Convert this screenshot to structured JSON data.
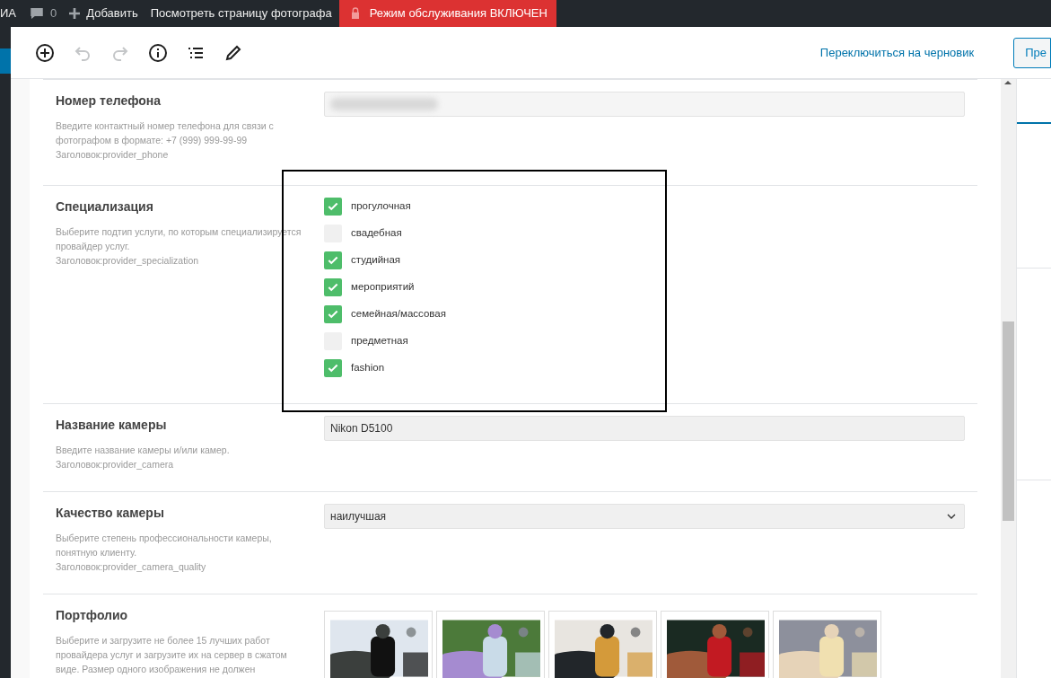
{
  "admin_bar": {
    "site_fragment": "ИА",
    "comments_count": "0",
    "add_label": "Добавить",
    "view_label": "Посмотреть страницу фотографа",
    "maintenance_label": "Режим обслуживания ВКЛЮЧЕН"
  },
  "toolbar": {
    "undo_disabled": true,
    "redo_disabled": true,
    "switch_link": "Переключиться на черновик",
    "preview_button": "Пре"
  },
  "fields": [
    {
      "kind": "text",
      "label": "Номер телефона",
      "description": [
        "Введите контактный номер телефона для связи с",
        "фотографом в формате: +7 (999) 999-99-99",
        "Заголовок:provider_phone"
      ],
      "blurred": true
    },
    {
      "kind": "checkboxes",
      "label": "Специализация",
      "description": [
        "Выберите подтип услуги, по которым специализируется",
        "провайдер услуг.",
        "Заголовок:provider_specialization"
      ],
      "options": [
        {
          "label": "прогулочная",
          "checked": true
        },
        {
          "label": "свадебная",
          "checked": false
        },
        {
          "label": "студийная",
          "checked": true
        },
        {
          "label": "мероприятий",
          "checked": true
        },
        {
          "label": "семейная/массовая",
          "checked": true
        },
        {
          "label": "предметная",
          "checked": false
        },
        {
          "label": "fashion",
          "checked": true
        }
      ]
    },
    {
      "kind": "text",
      "label": "Название камеры",
      "description": [
        "Введите название камеры и/или камер.",
        "Заголовок:provider_camera"
      ],
      "value": "Nikon D5100"
    },
    {
      "kind": "select",
      "label": "Качество камеры",
      "description": [
        "Выберите степень профессиональности камеры,",
        "понятную клиенту.",
        "Заголовок:provider_camera_quality"
      ],
      "value": "наилучшая"
    },
    {
      "kind": "gallery",
      "label": "Портфолио",
      "description": [
        "Выберите и загрузите не более 15 лучших работ",
        "провайдера услуг и загрузите их на сервер в сжатом",
        "виде. Размер одного изображения не должен"
      ]
    }
  ]
}
